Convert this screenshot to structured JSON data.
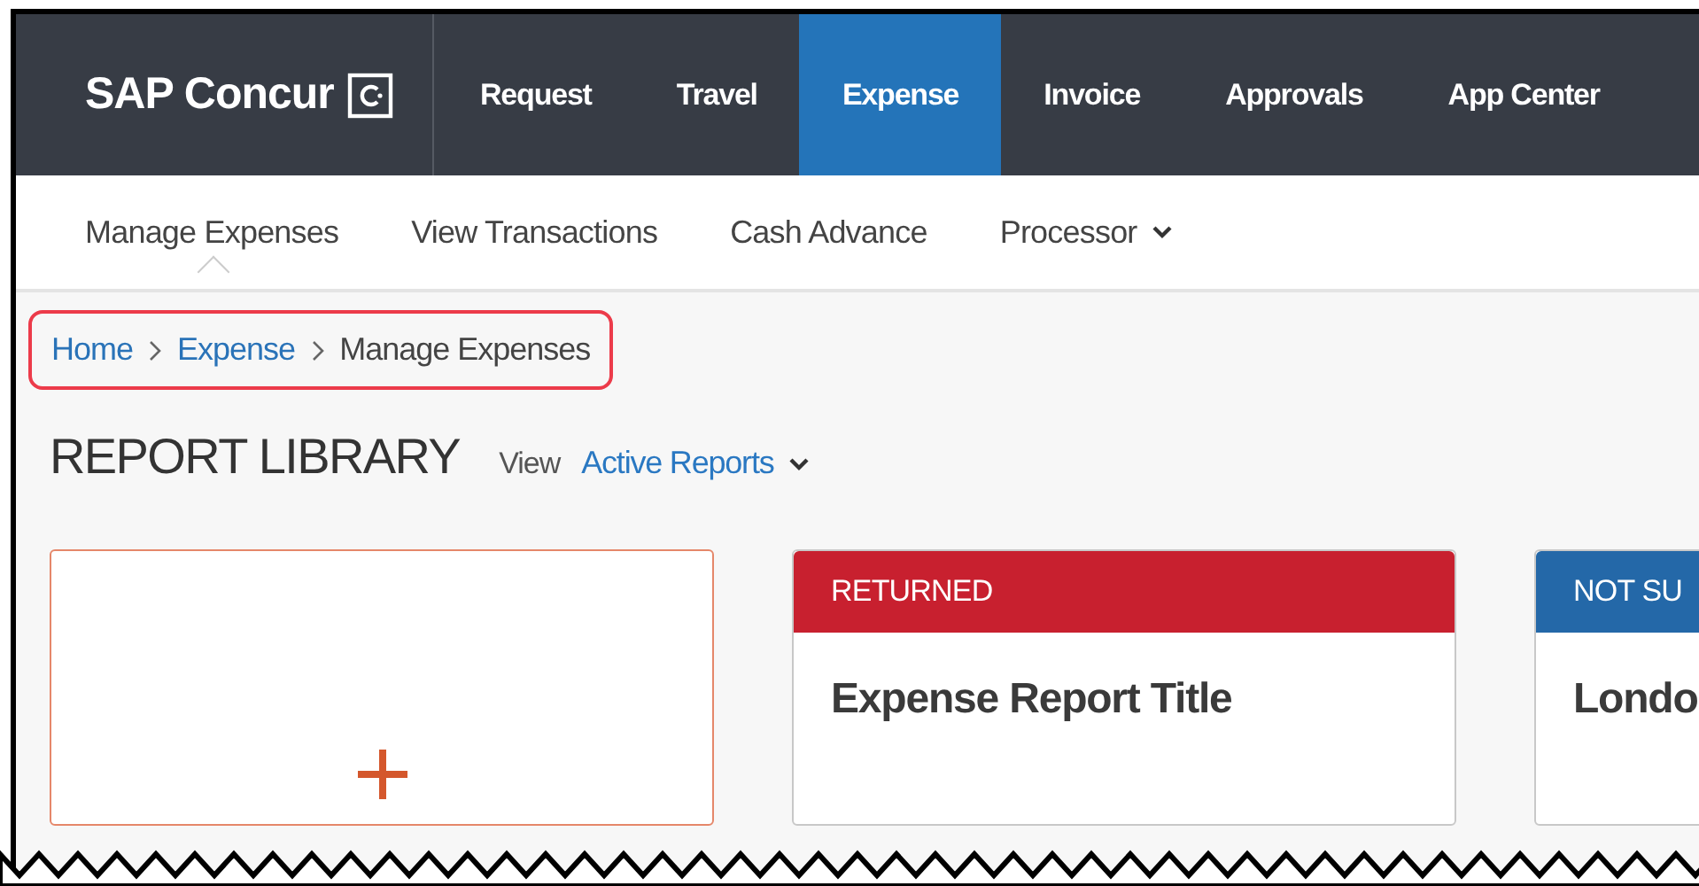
{
  "nav": {
    "logo": "SAP Concur",
    "tabs": [
      {
        "label": "Request",
        "selected": false
      },
      {
        "label": "Travel",
        "selected": false
      },
      {
        "label": "Expense",
        "selected": true
      },
      {
        "label": "Invoice",
        "selected": false
      },
      {
        "label": "Approvals",
        "selected": false
      },
      {
        "label": "App Center",
        "selected": false
      }
    ]
  },
  "subnav": {
    "items": [
      {
        "label": "Manage Expenses",
        "selected": true,
        "kind": "link"
      },
      {
        "label": "View Transactions",
        "selected": false,
        "kind": "link"
      },
      {
        "label": "Cash Advance",
        "selected": false,
        "kind": "link"
      },
      {
        "label": "Processor",
        "selected": false,
        "kind": "dropdown"
      }
    ]
  },
  "breadcrumb": {
    "highlighted": true,
    "items": [
      {
        "label": "Home",
        "kind": "link"
      },
      {
        "label": "Expense",
        "kind": "link"
      },
      {
        "label": "Manage Expenses",
        "kind": "current"
      }
    ]
  },
  "page_title": "REPORT LIBRARY",
  "view_label": "View",
  "view_value": "Active Reports",
  "cards": [
    {
      "kind": "create"
    },
    {
      "kind": "report",
      "status": "RETURNED",
      "color": "#c8202f",
      "title": "Expense Report Title"
    },
    {
      "kind": "report",
      "status": "NOT SU",
      "color": "#2468a8",
      "title": "Londo"
    }
  ]
}
